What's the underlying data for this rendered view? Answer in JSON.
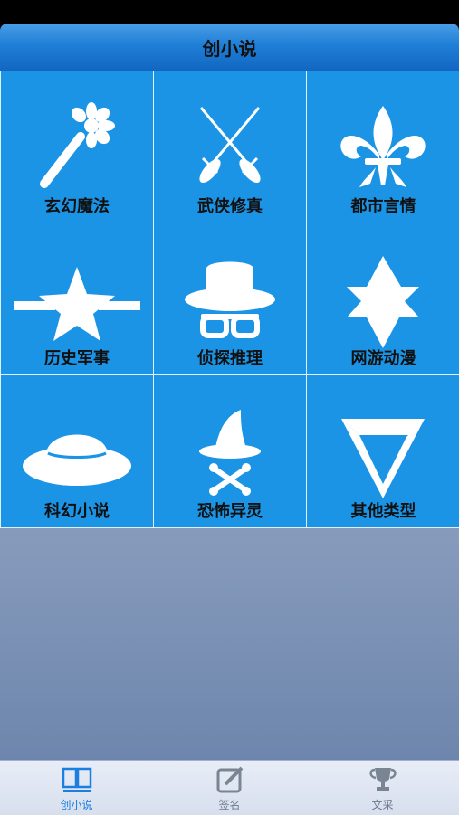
{
  "nav": {
    "title": "创小说"
  },
  "categories": [
    {
      "label": "玄幻魔法",
      "icon": "magic-wand-icon"
    },
    {
      "label": "武侠修真",
      "icon": "crossed-swords-icon"
    },
    {
      "label": "都市言情",
      "icon": "fleur-de-lis-icon"
    },
    {
      "label": "历史军事",
      "icon": "star-badge-icon"
    },
    {
      "label": "侦探推理",
      "icon": "detective-hat-glasses-icon"
    },
    {
      "label": "网游动漫",
      "icon": "six-point-star-icon"
    },
    {
      "label": "科幻小说",
      "icon": "sun-hat-icon"
    },
    {
      "label": "恐怖异灵",
      "icon": "witch-hat-crossbones-icon"
    },
    {
      "label": "其他类型",
      "icon": "triangle-logo-icon"
    }
  ],
  "tabs": [
    {
      "label": "创小说",
      "icon": "book-icon",
      "active": true
    },
    {
      "label": "签名",
      "icon": "edit-icon",
      "active": false
    },
    {
      "label": "文采",
      "icon": "trophy-icon",
      "active": false
    }
  ],
  "colors": {
    "accent": "#1b94e6",
    "tab_active": "#1a7fe0",
    "tab_inactive": "#6d7a8c"
  }
}
